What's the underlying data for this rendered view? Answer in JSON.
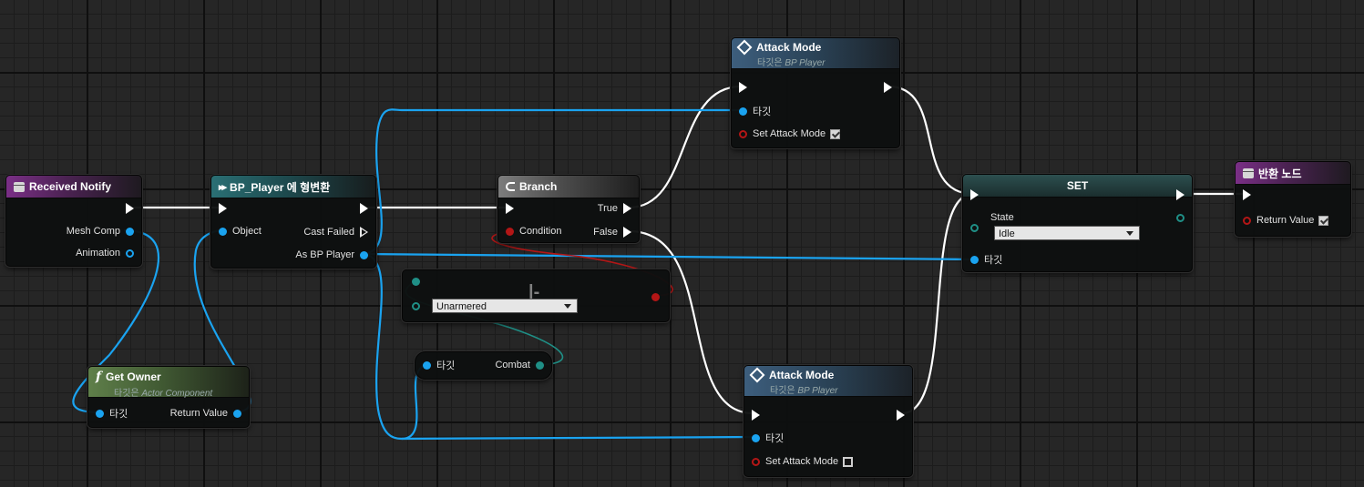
{
  "nodes": {
    "received_notify": {
      "title": "Received Notify",
      "pins": {
        "mesh_comp": "Mesh Comp",
        "animation": "Animation"
      }
    },
    "cast": {
      "title": "BP_Player 에 형변환",
      "pins": {
        "object": "Object",
        "cast_failed": "Cast Failed",
        "as_bp_player": "As BP Player"
      }
    },
    "get_owner": {
      "title": "Get Owner",
      "subtitle_prefix": "타깃은 ",
      "subtitle_class": "Actor Component",
      "pins": {
        "target": "타깃",
        "return_value": "Return Value"
      }
    },
    "branch": {
      "title": "Branch",
      "pins": {
        "condition": "Condition",
        "true": "True",
        "false": "False"
      }
    },
    "equal": {
      "glyph": "|-",
      "dropdown_value": "Unarmered"
    },
    "combat_var": {
      "pins": {
        "target": "타깃",
        "combat": "Combat"
      }
    },
    "attack_mode_top": {
      "title": "Attack Mode",
      "subtitle_prefix": "타깃은 ",
      "subtitle_class": "BP Player",
      "pins": {
        "target": "타깃",
        "set_attack_mode": "Set Attack Mode"
      },
      "checked": true
    },
    "attack_mode_bottom": {
      "title": "Attack Mode",
      "subtitle_prefix": "타깃은 ",
      "subtitle_class": "BP Player",
      "pins": {
        "target": "타깃",
        "set_attack_mode": "Set Attack Mode"
      },
      "checked": false
    },
    "set": {
      "title": "SET",
      "pins": {
        "state": "State",
        "target": "타깃"
      },
      "state_value": "Idle"
    },
    "return_node": {
      "title": "반환 노드",
      "pins": {
        "return_value": "Return Value"
      },
      "checked": true
    }
  },
  "colors": {
    "exec_wire": "#ffffff",
    "object_wire": "#1aa3f0",
    "bool_wire": "#b31616",
    "enum_wire": "#1f8f86"
  }
}
